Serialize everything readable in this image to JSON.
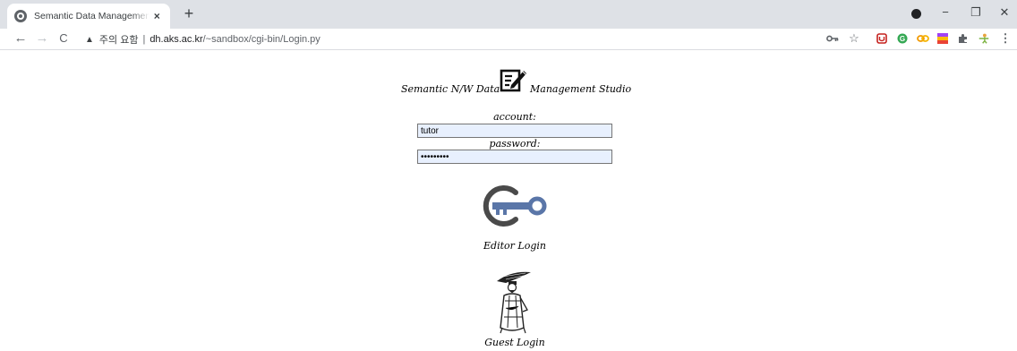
{
  "browser": {
    "tab_title": "Semantic Data Management St",
    "tab_close": "×",
    "new_tab": "+",
    "window_controls": {
      "minimize": "−",
      "restore": "❐",
      "close": "✕"
    },
    "nav": {
      "back": "←",
      "forward": "→",
      "reload": "C"
    },
    "security_warning": "주의 요함",
    "security_icon": "▲",
    "separator": "|",
    "url_host": "dh.aks.ac.kr",
    "url_path": "/~sandbox/cgi-bin/Login.py",
    "toolbar_icons": [
      "key-icon",
      "star-icon",
      "extension-red-icon",
      "extension-green-icon",
      "extension-orange-icon",
      "extension-colorful-icon",
      "puzzle-icon",
      "profile-figure-icon",
      "menu-icon"
    ],
    "colors": {
      "tabstrip": "#dee1e6",
      "field_autofill": "#e8f0fe",
      "key_icon_blue": "#5a76a8",
      "key_icon_gray": "#4a4a4a"
    }
  },
  "page": {
    "title_left": "Semantic N/W Data",
    "title_right": "Management Studio",
    "account_label": "account:",
    "account_value": "tutor",
    "password_label": "password:",
    "password_value": "password1",
    "editor_login": "Editor Login",
    "guest_login": "Guest Login"
  }
}
